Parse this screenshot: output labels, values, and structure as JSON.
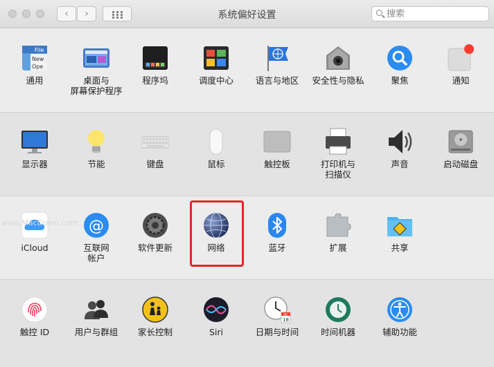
{
  "window": {
    "title": "系统偏好设置",
    "search_placeholder": "搜索",
    "back_glyph": "‹",
    "forward_glyph": "›"
  },
  "rows": [
    [
      {
        "label": "通用",
        "icon": "general-icon",
        "icon_text": "File\nNew\nOpe"
      },
      {
        "label": "桌面与\n屏幕保护程序",
        "icon": "desktop-screensaver-icon"
      },
      {
        "label": "程序坞",
        "icon": "dock-icon"
      },
      {
        "label": "调度中心",
        "icon": "mission-control-icon"
      },
      {
        "label": "语言与地区",
        "icon": "language-region-icon"
      },
      {
        "label": "安全性与隐私",
        "icon": "security-privacy-icon"
      },
      {
        "label": "聚焦",
        "icon": "spotlight-icon"
      },
      {
        "label": "通知",
        "icon": "notifications-icon"
      }
    ],
    [
      {
        "label": "显示器",
        "icon": "displays-icon"
      },
      {
        "label": "节能",
        "icon": "energy-saver-icon"
      },
      {
        "label": "键盘",
        "icon": "keyboard-icon"
      },
      {
        "label": "鼠标",
        "icon": "mouse-icon"
      },
      {
        "label": "触控板",
        "icon": "trackpad-icon"
      },
      {
        "label": "打印机与\n扫描仪",
        "icon": "printers-scanners-icon"
      },
      {
        "label": "声音",
        "icon": "sound-icon"
      },
      {
        "label": "启动磁盘",
        "icon": "startup-disk-icon"
      }
    ],
    [
      {
        "label": "iCloud",
        "icon": "icloud-icon"
      },
      {
        "label": "互联网\n帐户",
        "icon": "internet-accounts-icon",
        "icon_text": "@"
      },
      {
        "label": "软件更新",
        "icon": "software-update-icon"
      },
      {
        "label": "网络",
        "icon": "network-icon",
        "highlighted": true
      },
      {
        "label": "蓝牙",
        "icon": "bluetooth-icon"
      },
      {
        "label": "扩展",
        "icon": "extensions-icon"
      },
      {
        "label": "共享",
        "icon": "sharing-icon"
      }
    ],
    [
      {
        "label": "触控 ID",
        "icon": "touch-id-icon"
      },
      {
        "label": "用户与群组",
        "icon": "users-groups-icon"
      },
      {
        "label": "家长控制",
        "icon": "parental-controls-icon"
      },
      {
        "label": "Siri",
        "icon": "siri-icon"
      },
      {
        "label": "日期与时间",
        "icon": "date-time-icon",
        "icon_text": "JUL\n18"
      },
      {
        "label": "时间机器",
        "icon": "time-machine-icon"
      },
      {
        "label": "辅助功能",
        "icon": "accessibility-icon"
      }
    ]
  ],
  "watermark": "www.MacDown.com",
  "colors": {
    "highlight": "#e0262a",
    "accent_blue": "#1f7ef0"
  }
}
